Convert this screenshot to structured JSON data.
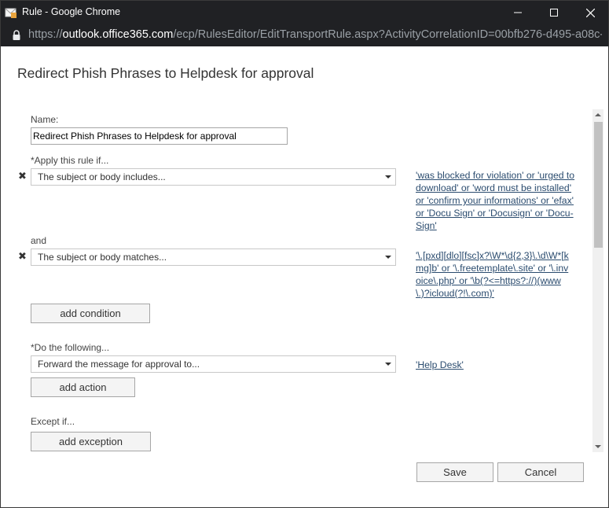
{
  "window": {
    "title": "Rule - Google Chrome",
    "icon": "outlook-mail-icon"
  },
  "address": {
    "scheme": "https://",
    "host": "outlook.office365.com",
    "path": "/ecp/RulesEditor/EditTransportRule.aspx?ActivityCorrelationID=00bfb276-d495-a08c-..."
  },
  "page": {
    "title": "Redirect Phish Phrases to Helpdesk for approval"
  },
  "form": {
    "name_label": "Name:",
    "name_value": "Redirect Phish Phrases to Helpdesk for approval",
    "apply_label": "*Apply this rule if...",
    "conditions": [
      {
        "remove": "✖",
        "dropdown": "The subject or body includes...",
        "value": "'was blocked for violation' or 'urged to download' or 'word must be installed' or 'confirm your informations' or 'efax' or 'Docu Sign' or 'Docusign' or 'Docu-Sign'"
      },
      {
        "remove": "✖",
        "dropdown": "The subject or body matches...",
        "value": "'\\.[pxd][dlo][fsc]x?\\W*\\d{2,3}\\.\\d\\W*[kmg]b' or '\\.freetemplate\\.site' or '\\.invoice\\.php' or '\\b(?<=https?://)(www\\.)?icloud(?!\\.com)'"
      }
    ],
    "and_label": "and",
    "add_condition": "add condition",
    "do_label": "*Do the following...",
    "action_dropdown": "Forward the message for approval to...",
    "action_value": "'Help Desk'",
    "add_action": "add action",
    "except_label": "Except if...",
    "add_exception": "add exception"
  },
  "footer": {
    "save": "Save",
    "cancel": "Cancel"
  }
}
